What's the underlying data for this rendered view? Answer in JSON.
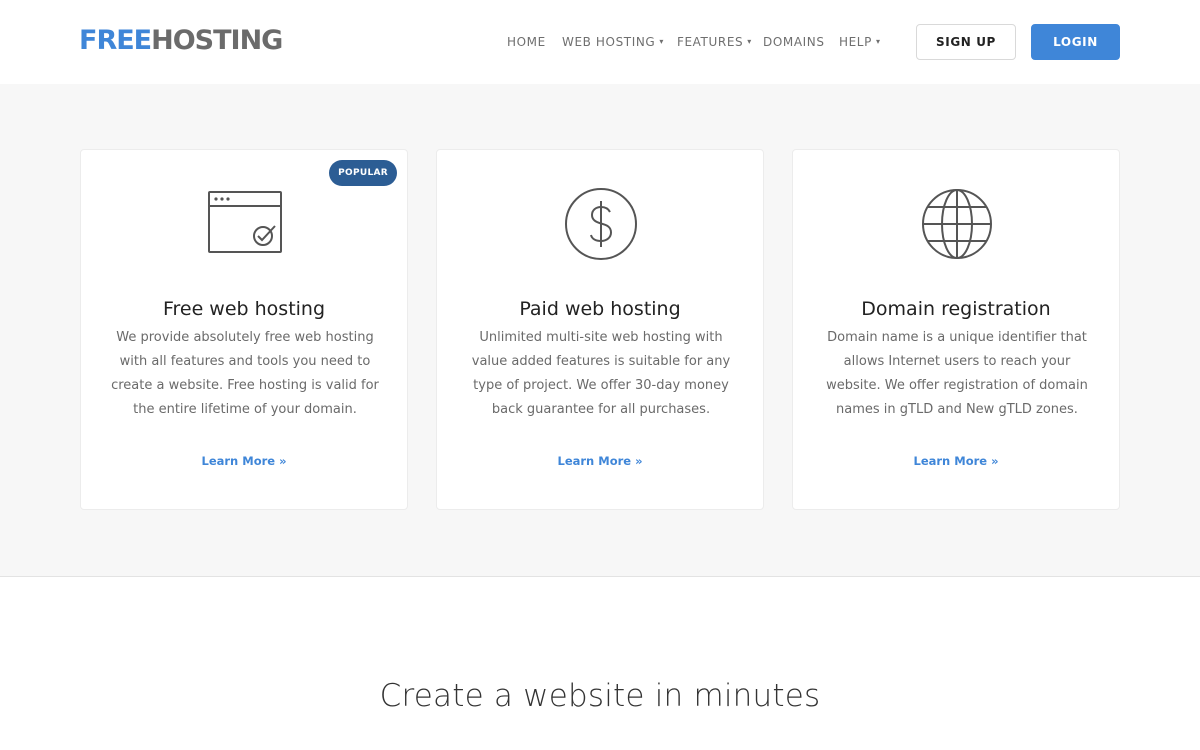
{
  "brand": {
    "logo_part1": "FREE",
    "logo_part2": "HOSTING",
    "accent_color": "#3f86d8",
    "logo_gray": "#6b6b6b"
  },
  "nav": {
    "items": [
      {
        "label": "HOME",
        "has_dropdown": false
      },
      {
        "label": "WEB HOSTING",
        "has_dropdown": true
      },
      {
        "label": "FEATURES",
        "has_dropdown": true
      },
      {
        "label": "DOMAINS",
        "has_dropdown": false
      },
      {
        "label": "HELP",
        "has_dropdown": true
      }
    ],
    "caret_icon": "chevron-down-icon"
  },
  "header_buttons": {
    "signup_label": "SIGN UP",
    "login_label": "LOGIN"
  },
  "cards": [
    {
      "icon": "browser-window-check-icon",
      "badge": "POPULAR",
      "title": "Free web hosting",
      "description": "We provide absolutely free web hosting with all features and tools you need to create a website. Free hosting is valid for the entire lifetime of your domain.",
      "link": "Learn More »"
    },
    {
      "icon": "dollar-circle-icon",
      "title": "Paid web hosting",
      "description": "Unlimited multi-site web hosting with value added features is suitable for any type of project. We offer 30-day money back guarantee for all purchases.",
      "link": "Learn More »"
    },
    {
      "icon": "globe-icon",
      "title": "Domain registration",
      "description": "Domain name is a unique identifier that allows Internet users to reach your website. We offer registration of domain names in gTLD and New gTLD zones.",
      "link": "Learn More »"
    }
  ],
  "cta": {
    "title": "Create a website in minutes"
  },
  "colors": {
    "badge_bg": "#2c5d94",
    "section_bg": "#f7f7f7",
    "link": "#3f86d8"
  }
}
